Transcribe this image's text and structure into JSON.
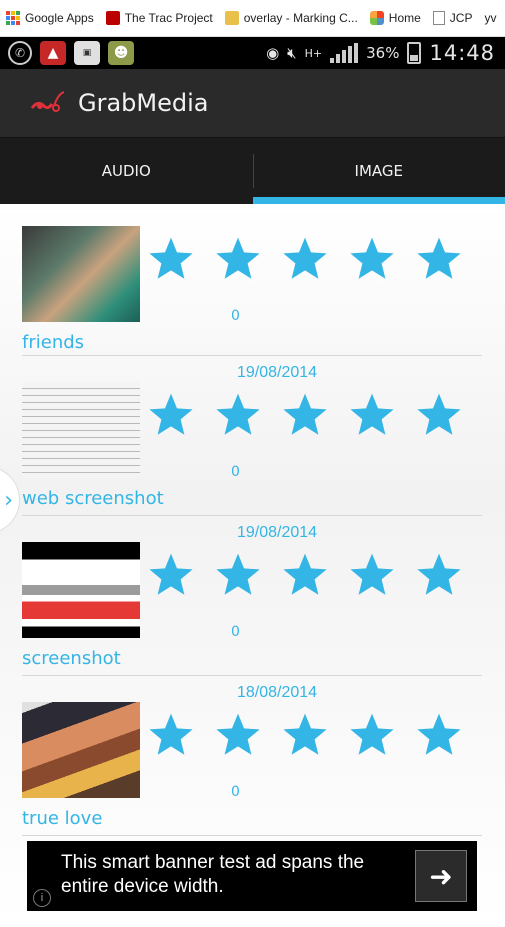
{
  "browser": {
    "bookmarks": [
      {
        "label": "Google Apps",
        "icon": "apps-grid-icon"
      },
      {
        "label": "The Trac Project",
        "icon": "trac-icon"
      },
      {
        "label": "overlay - Marking C...",
        "icon": "overlay-icon"
      },
      {
        "label": "Home",
        "icon": "joomla-icon"
      },
      {
        "label": "JCP",
        "icon": "page-icon"
      },
      {
        "label": "yv",
        "icon": ""
      }
    ]
  },
  "statusbar": {
    "network_label": "H+",
    "battery": "36%",
    "time": "14:48"
  },
  "actionbar": {
    "title": "GrabMedia"
  },
  "tabs": [
    {
      "label": "AUDIO",
      "active": false
    },
    {
      "label": "IMAGE",
      "active": true
    }
  ],
  "items": [
    {
      "date": "",
      "rating": "0",
      "title": "friends",
      "stars": 5
    },
    {
      "date": "19/08/2014",
      "rating": "0",
      "title": "web screenshot",
      "stars": 5
    },
    {
      "date": "19/08/2014",
      "rating": "0",
      "title": "screenshot",
      "stars": 5
    },
    {
      "date": "18/08/2014",
      "rating": "0",
      "title": "true love",
      "stars": 5
    }
  ],
  "ad": {
    "text": "This smart banner test ad spans the entire device width.",
    "info_label": "i"
  },
  "colors": {
    "accent": "#33b5e5",
    "actionbar": "#2a2a2a",
    "tabs": "#1b1b1b"
  }
}
